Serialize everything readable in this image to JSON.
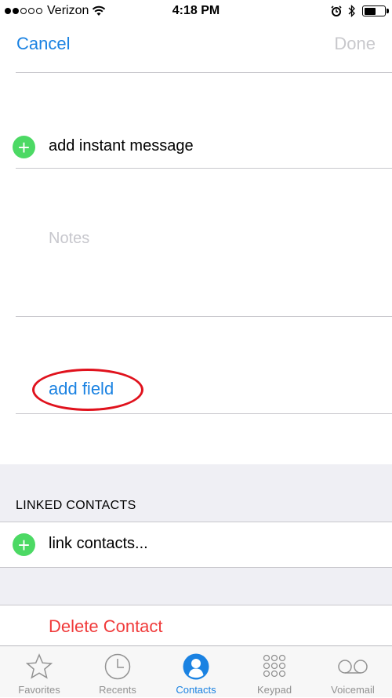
{
  "status_bar": {
    "carrier": "Verizon",
    "time": "4:18 PM",
    "signal_bars_filled": 2,
    "signal_bars_total": 5,
    "battery_level": 0.6
  },
  "nav": {
    "cancel_label": "Cancel",
    "done_label": "Done"
  },
  "rows": {
    "add_instant_message": "add instant message",
    "notes_placeholder": "Notes",
    "add_field": "add field"
  },
  "linked_contacts": {
    "header": "LINKED CONTACTS",
    "link_label": "link contacts..."
  },
  "delete_label": "Delete Contact",
  "tabs": [
    {
      "label": "Favorites",
      "icon": "star-icon"
    },
    {
      "label": "Recents",
      "icon": "clock-icon"
    },
    {
      "label": "Contacts",
      "icon": "person-icon",
      "active": true
    },
    {
      "label": "Keypad",
      "icon": "keypad-icon"
    },
    {
      "label": "Voicemail",
      "icon": "voicemail-icon"
    }
  ],
  "colors": {
    "accent": "#1a82e2",
    "add_green": "#4cd964",
    "delete_red": "#f03a3a",
    "highlight_red": "#e0121d"
  }
}
